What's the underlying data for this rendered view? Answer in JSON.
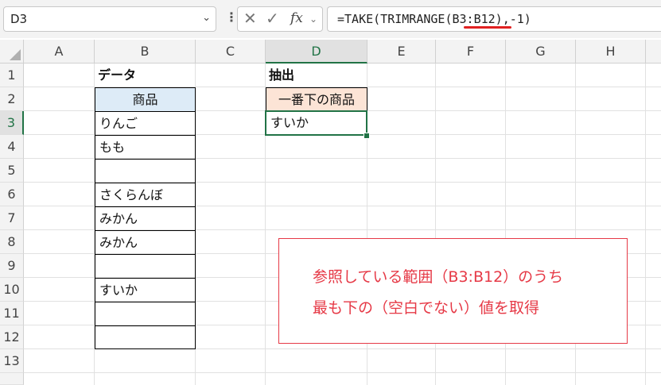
{
  "formula_bar": {
    "name_box": "D3",
    "formula": "=TAKE(TRIMRANGE(B3:B12),-1)",
    "fx_label": "fx",
    "cancel_icon": "x-icon",
    "enter_icon": "check-icon",
    "underline_color": "#e02020"
  },
  "grid": {
    "columns": [
      "A",
      "B",
      "C",
      "D",
      "E",
      "F",
      "G",
      "H"
    ],
    "selected_column": "D",
    "rows": [
      "1",
      "2",
      "3",
      "4",
      "5",
      "6",
      "7",
      "8",
      "9",
      "10",
      "11",
      "12",
      "13"
    ],
    "selected_row": "3"
  },
  "cells": {
    "B1": "データ",
    "B2": "商品",
    "B3": "りんご",
    "B4": "もも",
    "B5": "",
    "B6": "さくらんぼ",
    "B7": "みかん",
    "B8": "みかん",
    "B9": "",
    "B10": "すいか",
    "B11": "",
    "B12": "",
    "D1": "抽出",
    "D2": "一番下の商品",
    "D3": "すいか"
  },
  "annotation": {
    "line1": "参照している範囲（B3:B12）のうち",
    "line2": "最も下の（空白でない）値を取得",
    "color": "#e63946"
  }
}
